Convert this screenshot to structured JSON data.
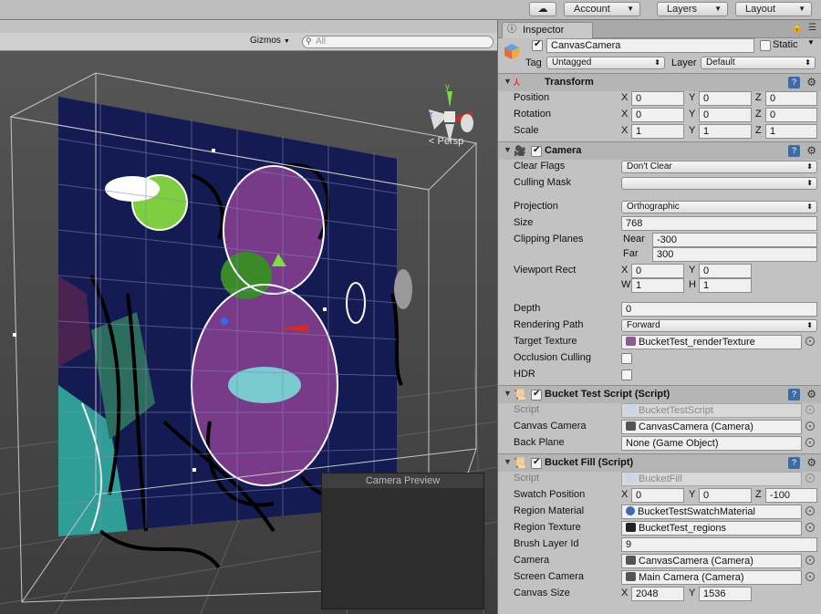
{
  "toolbar": {
    "account": "Account",
    "layers": "Layers",
    "layout": "Layout"
  },
  "scene": {
    "gizmos": "Gizmos",
    "search_placeholder": "All",
    "persp": "Persp",
    "camera_preview": "Camera Preview"
  },
  "inspector": {
    "tab": "Inspector",
    "object_name": "CanvasCamera",
    "static_label": "Static",
    "tag_label": "Tag",
    "tag_value": "Untagged",
    "layer_label": "Layer",
    "layer_value": "Default",
    "transform": {
      "title": "Transform",
      "rows": [
        {
          "label": "Position",
          "x": "0",
          "y": "0",
          "z": "0"
        },
        {
          "label": "Rotation",
          "x": "0",
          "y": "0",
          "z": "0"
        },
        {
          "label": "Scale",
          "x": "1",
          "y": "1",
          "z": "1"
        }
      ]
    },
    "camera": {
      "title": "Camera",
      "clear_flags_label": "Clear Flags",
      "clear_flags": "Don't Clear",
      "culling_mask_label": "Culling Mask",
      "culling_mask": "",
      "projection_label": "Projection",
      "projection": "Orthographic",
      "size_label": "Size",
      "size": "768",
      "clipping_label": "Clipping Planes",
      "near_label": "Near",
      "near": "-300",
      "far_label": "Far",
      "far": "300",
      "viewport_label": "Viewport Rect",
      "vx": "0",
      "vy": "0",
      "vw": "1",
      "vh": "1",
      "depth_label": "Depth",
      "depth": "0",
      "rendering_label": "Rendering Path",
      "rendering": "Forward",
      "target_texture_label": "Target Texture",
      "target_texture": "BucketTest_renderTexture",
      "occlusion_label": "Occlusion Culling",
      "hdr_label": "HDR"
    },
    "bucket_test": {
      "title": "Bucket Test Script (Script)",
      "script_label": "Script",
      "script": "BucketTestScript",
      "canvas_camera_label": "Canvas Camera",
      "canvas_camera": "CanvasCamera (Camera)",
      "back_plane_label": "Back Plane",
      "back_plane": "None (Game Object)"
    },
    "bucket_fill": {
      "title": "Bucket Fill (Script)",
      "script_label": "Script",
      "script": "BucketFill",
      "swatch_label": "Swatch Position",
      "sx": "0",
      "sy": "0",
      "sz": "-100",
      "region_material_label": "Region Material",
      "region_material": "BucketTestSwatchMaterial",
      "region_texture_label": "Region Texture",
      "region_texture": "BucketTest_regions",
      "brush_label": "Brush Layer Id",
      "brush": "9",
      "camera_label": "Camera",
      "camera": "CanvasCamera (Camera)",
      "screen_camera_label": "Screen Camera",
      "screen_camera": "Main Camera (Camera)",
      "canvas_size_label": "Canvas Size",
      "cx": "2048",
      "cy": "1536"
    },
    "axis": {
      "x": "X",
      "y": "Y",
      "z": "Z",
      "w": "W",
      "h": "H"
    }
  }
}
